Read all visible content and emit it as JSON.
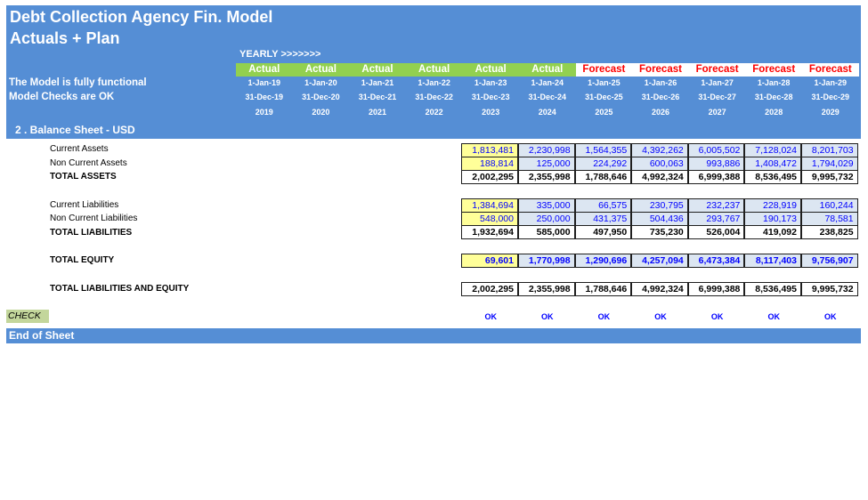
{
  "title": {
    "line1": "Debt Collection Agency Fin. Model",
    "line2": "Actuals + Plan"
  },
  "yearly_label": "YEARLY >>>>>>>",
  "status": {
    "line1": "The Model is fully functional",
    "line2": "Model Checks are OK"
  },
  "periods": [
    {
      "type": "Actual",
      "start": "1-Jan-19",
      "end": "31-Dec-19",
      "year": "2019"
    },
    {
      "type": "Actual",
      "start": "1-Jan-20",
      "end": "31-Dec-20",
      "year": "2020"
    },
    {
      "type": "Actual",
      "start": "1-Jan-21",
      "end": "31-Dec-21",
      "year": "2021"
    },
    {
      "type": "Actual",
      "start": "1-Jan-22",
      "end": "31-Dec-22",
      "year": "2022"
    },
    {
      "type": "Actual",
      "start": "1-Jan-23",
      "end": "31-Dec-23",
      "year": "2023"
    },
    {
      "type": "Actual",
      "start": "1-Jan-24",
      "end": "31-Dec-24",
      "year": "2024"
    },
    {
      "type": "Forecast",
      "start": "1-Jan-25",
      "end": "31-Dec-25",
      "year": "2025"
    },
    {
      "type": "Forecast",
      "start": "1-Jan-26",
      "end": "31-Dec-26",
      "year": "2026"
    },
    {
      "type": "Forecast",
      "start": "1-Jan-27",
      "end": "31-Dec-27",
      "year": "2027"
    },
    {
      "type": "Forecast",
      "start": "1-Jan-28",
      "end": "31-Dec-28",
      "year": "2028"
    },
    {
      "type": "Forecast",
      "start": "1-Jan-29",
      "end": "31-Dec-29",
      "year": "2029"
    }
  ],
  "section_title": "2 . Balance Sheet - USD",
  "labels": {
    "current_assets": "Current Assets",
    "non_current_assets": "Non Current Assets",
    "total_assets": "TOTAL ASSETS",
    "current_liabilities": "Current Liabilities",
    "non_current_liabilities": "Non Current Liabilities",
    "total_liabilities": "TOTAL LIABILITIES",
    "total_equity": "TOTAL EQUITY",
    "total_liabilities_equity": "TOTAL LIABILITIES AND EQUITY",
    "check": "CHECK",
    "end": "End of Sheet"
  },
  "values": {
    "current_assets": [
      "1,813,481",
      "2,230,998",
      "1,564,355",
      "4,392,262",
      "6,005,502",
      "7,128,024",
      "8,201,703"
    ],
    "non_current_assets": [
      "188,814",
      "125,000",
      "224,292",
      "600,063",
      "993,886",
      "1,408,472",
      "1,794,029"
    ],
    "total_assets": [
      "2,002,295",
      "2,355,998",
      "1,788,646",
      "4,992,324",
      "6,999,388",
      "8,536,495",
      "9,995,732"
    ],
    "current_liabilities": [
      "1,384,694",
      "335,000",
      "66,575",
      "230,795",
      "232,237",
      "228,919",
      "160,244"
    ],
    "non_current_liabilities": [
      "548,000",
      "250,000",
      "431,375",
      "504,436",
      "293,767",
      "190,173",
      "78,581"
    ],
    "total_liabilities": [
      "1,932,694",
      "585,000",
      "497,950",
      "735,230",
      "526,004",
      "419,092",
      "238,825"
    ],
    "total_equity": [
      "69,601",
      "1,770,998",
      "1,290,696",
      "4,257,094",
      "6,473,384",
      "8,117,403",
      "9,756,907"
    ],
    "total_liabilities_equity": [
      "2,002,295",
      "2,355,998",
      "1,788,646",
      "4,992,324",
      "6,999,388",
      "8,536,495",
      "9,995,732"
    ],
    "check": [
      "OK",
      "OK",
      "OK",
      "OK",
      "OK",
      "OK",
      "OK"
    ]
  },
  "colors": {
    "header_blue": "#558ed5",
    "actual_green": "#92d050",
    "forecast_red": "#ff0000",
    "input_yellow": "#ffff99",
    "input_blue": "#dce6f2",
    "check_green": "#c3d69b",
    "value_blue": "#0000ff"
  }
}
